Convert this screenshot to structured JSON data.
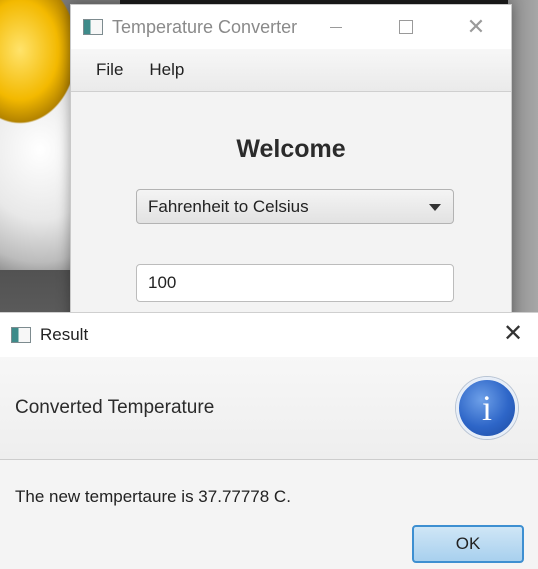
{
  "main_window": {
    "title": "Temperature Converter",
    "menu": [
      "File",
      "Help"
    ],
    "heading": "Welcome",
    "conversion_select": {
      "selected": "Fahrenheit to Celsius"
    },
    "input_value": "100",
    "icons": {
      "app": "app-icon",
      "minimize": "minimize-icon",
      "maximize": "maximize-icon",
      "close": "close-icon"
    }
  },
  "result_dialog": {
    "title": "Result",
    "header": "Converted Temperature",
    "message": "The new tempertaure is 37.77778 C.",
    "ok_label": "OK",
    "icons": {
      "app": "app-icon",
      "close": "close-icon",
      "info": "info-icon"
    },
    "info_glyph": "i"
  },
  "colors": {
    "accent_button_border": "#3d8fd1",
    "info_icon": "#2e66c8"
  }
}
